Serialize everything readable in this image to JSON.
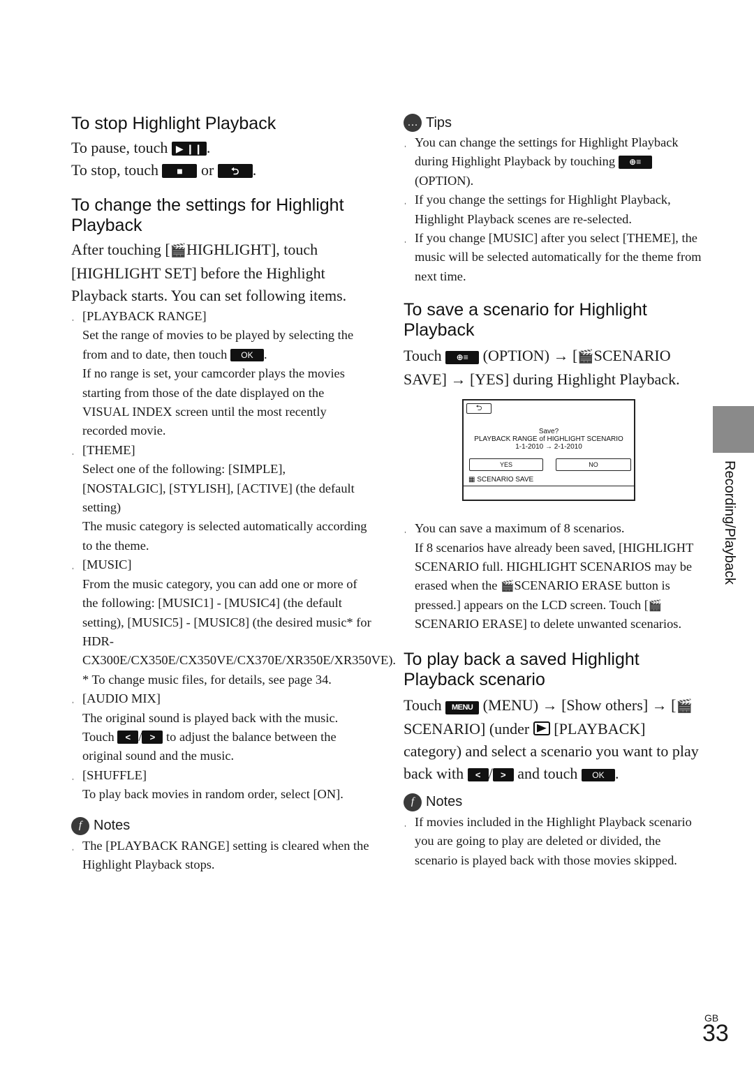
{
  "stop": {
    "heading": "To stop Highlight Playback",
    "pause_text": "To pause, touch",
    "pause_button": "▶ ❙❙",
    "stop_text": "To stop, touch",
    "stop_button": "■",
    "or": "or",
    "return_button": "⮌"
  },
  "change": {
    "heading": "To change the settings for Highlight Playback",
    "intro_1": "After touching [",
    "intro_icon": "🎬",
    "intro_2": "HIGHLIGHT], touch [HIGHLIGHT SET] before the Highlight Playback starts. You can set following items.",
    "items": [
      {
        "label": "[PLAYBACK RANGE]",
        "text_1": "Set the range of movies to be played by selecting the from and to date, then touch",
        "ok": "OK",
        "text_2": "If no range is set, your camcorder plays the movies starting from those of the date displayed on the VISUAL INDEX screen until the most recently recorded movie."
      },
      {
        "label": "[THEME]",
        "text_1": "Select one of the following: [SIMPLE], [NOSTALGIC], [STYLISH], [ACTIVE] (the default setting)",
        "text_2": "The music category is selected automatically according to the theme."
      },
      {
        "label": "[MUSIC]",
        "text_1": "From the music category, you can add one or more of the following: [MUSIC1] - [MUSIC4] (the default setting), [MUSIC5] - [MUSIC8] (the desired music* for HDR-CX300E/CX350E/CX350VE/CX370E/XR350E/XR350VE).",
        "text_2": "* To change music files, for details, see page 34."
      },
      {
        "label": "[AUDIO MIX]",
        "text_1": "The original sound is played back with the music.",
        "touch": "Touch",
        "left": "<",
        "right": ">",
        "text_2": "to adjust the balance between the original sound and the music."
      },
      {
        "label": "[SHUFFLE]",
        "text_1": "To play back movies in random order, select [ON]."
      }
    ]
  },
  "notes_left": {
    "label": "Notes",
    "items": [
      "The [PLAYBACK RANGE] setting is cleared when the Highlight Playback stops."
    ]
  },
  "tips": {
    "label": "Tips",
    "items": [
      {
        "a": "You can change the settings for Highlight Playback during Highlight Playback by touching",
        "icon": "⊕≡",
        "b": "(OPTION)."
      },
      {
        "a": "If you change the settings for Highlight Playback, Highlight Playback scenes are re-selected."
      },
      {
        "a": "If you change [MUSIC] after you select [THEME], the music will be selected automatically for the theme from next time."
      }
    ]
  },
  "save": {
    "heading": "To save a scenario for Highlight Playback",
    "a": "Touch",
    "icon": "⊕≡",
    "b": "(OPTION) → [",
    "scen": "🎬",
    "c": "SCENARIO SAVE] → [YES] during Highlight Playback.",
    "screen": {
      "back": "⮌",
      "line1": "Save?",
      "line2": "PLAYBACK RANGE of HIGHLIGHT SCENARIO",
      "line3": "1-1-2010 → 2-1-2010",
      "yes": "YES",
      "no": "NO",
      "title": "SCENARIO SAVE"
    },
    "note_a": "You can save a maximum of 8 scenarios.",
    "note_b": "If 8 scenarios have already been saved, [HIGHLIGHT SCENARIO full. HIGHLIGHT SCENARIOS may be erased when the",
    "note_c": "SCENARIO ERASE button is pressed.] appears on the LCD screen. Touch [",
    "note_d": "SCENARIO ERASE] to delete unwanted scenarios."
  },
  "playback": {
    "heading": "To play back a saved Highlight Playback scenario",
    "a": "Touch",
    "menu": "MENU",
    "b": "(MENU) → [Show others] → [",
    "c": "SCENARIO] (under",
    "d": "[PLAYBACK] category) and select a scenario you want to play back with",
    "left": "<",
    "right": ">",
    "e": "and touch",
    "ok": "OK"
  },
  "notes_right": {
    "label": "Notes",
    "items": [
      "If movies included in the Highlight Playback scenario you are going to play are deleted or divided, the scenario is played back with those movies skipped."
    ]
  },
  "side": {
    "label": "Recording/Playback"
  },
  "footer": {
    "region": "GB",
    "page": "33"
  }
}
